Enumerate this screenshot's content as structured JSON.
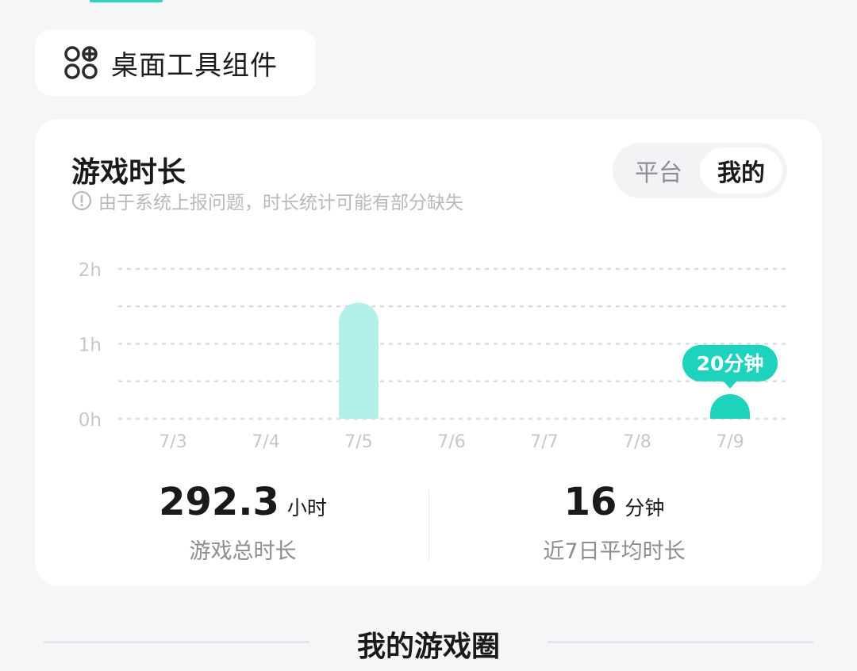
{
  "widget": {
    "label": "桌面工具组件",
    "icon": "widget-grid-plus-icon"
  },
  "card": {
    "title": "游戏时长",
    "notice": "由于系统上报问题，时长统计可能有部分缺失",
    "notice_icon": "info-circle-icon",
    "toggle": {
      "options": [
        "平台",
        "我的"
      ],
      "selected": "我的"
    }
  },
  "chart_data": {
    "type": "bar",
    "categories": [
      "7/3",
      "7/4",
      "7/5",
      "7/6",
      "7/7",
      "7/8",
      "7/9"
    ],
    "values": [
      0,
      0,
      1.55,
      0,
      0,
      0,
      0.33
    ],
    "unit": "h",
    "yticks": [
      "0h",
      "1h",
      "2h"
    ],
    "ylim": [
      0,
      2
    ],
    "grid": true,
    "highlight_index": 6,
    "highlight_label": "20分钟",
    "colors": {
      "normal": "#b3f0ea",
      "highlight": "#1dd3bd",
      "grid": "#dadde1",
      "tick": "#c4c7cb"
    }
  },
  "stats": {
    "total": {
      "value": "292.3",
      "unit": "小时",
      "caption": "游戏总时长"
    },
    "average": {
      "value": "16",
      "unit": "分钟",
      "caption": "近7日平均时长"
    }
  },
  "section": {
    "title": "我的游戏圈"
  },
  "colors": {
    "accent": "#2cd4c0",
    "background": "#f4f6f8",
    "card": "#ffffff"
  }
}
